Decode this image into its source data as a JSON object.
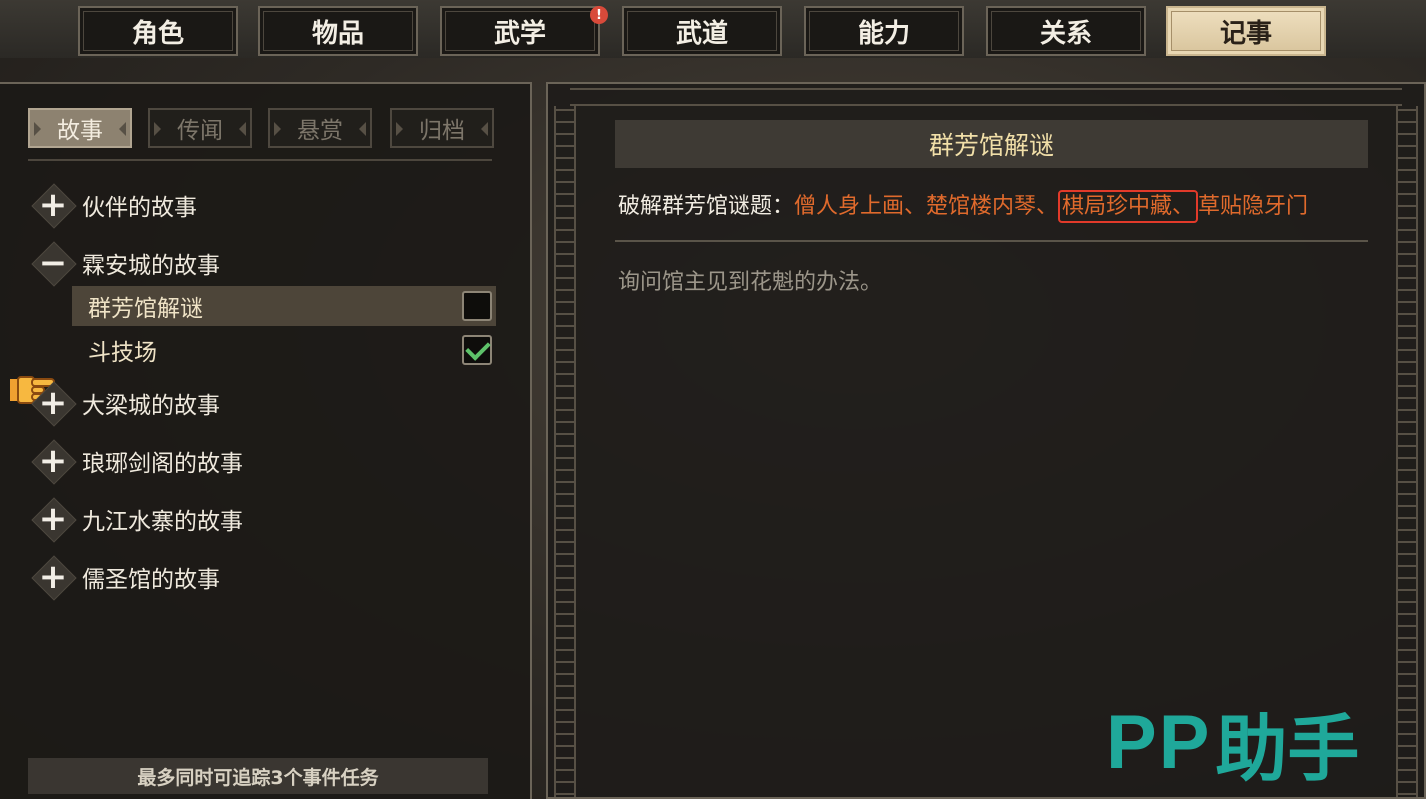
{
  "tabs": [
    {
      "label": "角色",
      "active": false
    },
    {
      "label": "物品",
      "active": false
    },
    {
      "label": "武学",
      "active": false,
      "notice": "!"
    },
    {
      "label": "武道",
      "active": false
    },
    {
      "label": "能力",
      "active": false
    },
    {
      "label": "关系",
      "active": false
    },
    {
      "label": "记事",
      "active": true
    }
  ],
  "subtabs": [
    {
      "label": "故事",
      "active": true
    },
    {
      "label": "传闻",
      "active": false
    },
    {
      "label": "悬赏",
      "active": false
    },
    {
      "label": "归档",
      "active": false
    }
  ],
  "stories": [
    {
      "label": "伙伴的故事",
      "expanded": false
    },
    {
      "label": "霖安城的故事",
      "expanded": true,
      "children": [
        {
          "label": "群芳馆解谜",
          "selected": true,
          "completed": false
        },
        {
          "label": "斗技场",
          "selected": false,
          "completed": true
        }
      ]
    },
    {
      "label": "大梁城的故事",
      "expanded": false
    },
    {
      "label": "琅琊剑阁的故事",
      "expanded": false
    },
    {
      "label": "九江水寨的故事",
      "expanded": false
    },
    {
      "label": "儒圣馆的故事",
      "expanded": false
    }
  ],
  "icons": {
    "expand": "+",
    "collapse": "−"
  },
  "footer_note": "最多同时可追踪3个事件任务",
  "detail": {
    "title": "群芳馆解谜",
    "riddle_prefix": "破解群芳馆谜题：",
    "riddle_part1": "僧人身上画、楚馆楼内琴、",
    "riddle_boxed": "棋局珍中藏、",
    "riddle_part2": "草贴隐牙门",
    "description": "询问馆主见到花魁的办法。"
  },
  "watermark": {
    "latin": "PP",
    "chinese": "助手"
  },
  "colors": {
    "accent_orange": "#e06a2c",
    "highlight_box": "#e23a2a",
    "check_green": "#5ec26a",
    "watermark": "#1fa89a"
  }
}
